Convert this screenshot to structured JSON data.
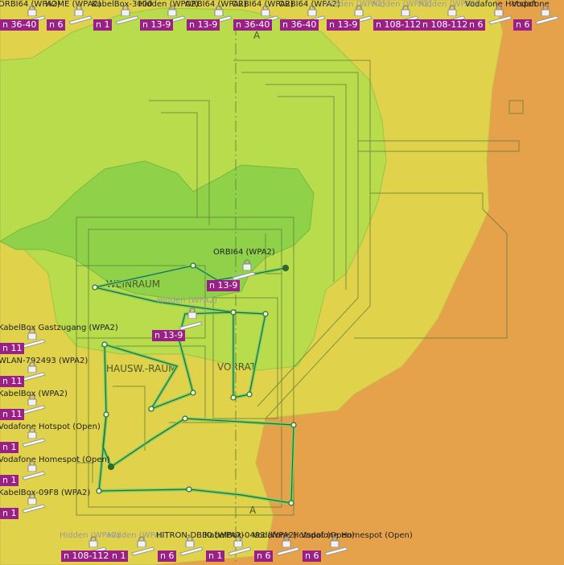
{
  "colors": {
    "strong": "#8fd24a",
    "good": "#b8dc4c",
    "ok": "#e0d24a",
    "weak": "#e6a24a",
    "channel_badge": "#9b1f86",
    "path": "#1e6b1e"
  },
  "rooms": {
    "weinraum": "WEINRAUM",
    "hausw_raum": "HAUSW.-RAUM",
    "vorrat": "VORRAT",
    "axis_top": "A",
    "axis_bottom": "A"
  },
  "top_row": [
    {
      "label": "ORBI64 (WPA2)",
      "channel": "n 36-40",
      "faded": false
    },
    {
      "label": "HOME (WPA2)",
      "channel": "n 6",
      "faded": false
    },
    {
      "label": "KabelBox-3000",
      "channel": "n 1",
      "faded": false
    },
    {
      "label": "Hidden (WPA2)",
      "channel": "n 13-9",
      "faded": false
    },
    {
      "label": "ORBI64 (WPA2)",
      "channel": "n 13-9",
      "faded": false
    },
    {
      "label": "ORBI64 (WPA2)",
      "channel": "n 36-40",
      "faded": false
    },
    {
      "label": "ORBI64 (WPA2)",
      "channel": "n 36-40",
      "faded": false
    },
    {
      "label": "Hidden (WPA2)",
      "channel": "n 13-9",
      "faded": true
    },
    {
      "label": "Hidden (WPA2)",
      "channel": "n 108-112",
      "faded": true
    },
    {
      "label": "Hidden (WPA2)",
      "channel": "n 108-112",
      "faded": true
    },
    {
      "label": "Vodafone Hotspot",
      "channel": "n 6",
      "faded": false
    },
    {
      "label": "Vodafone",
      "channel": "n 6",
      "faded": false
    }
  ],
  "left_column": [
    {
      "label": "KabelBox Gastzugang (WPA2)",
      "channel": "n 11"
    },
    {
      "label": "WLAN-792493 (WPA2)",
      "channel": "n 11"
    },
    {
      "label": "KabelBox (WPA2)",
      "channel": "n 11"
    },
    {
      "label": "Vodafone Hotspot (Open)",
      "channel": "n 1"
    },
    {
      "label": "Vodafone Homespot (Open)",
      "channel": "n 1"
    },
    {
      "label": "KabelBox-09F8 (WPA2)",
      "channel": "n 1"
    }
  ],
  "bottom_row": [
    {
      "label": "Hidden (WPA2)",
      "channel": "n 108-112",
      "faded": true
    },
    {
      "label": "Hidden (WPA2)",
      "channel": "n 1",
      "faded": true
    },
    {
      "label": "HITRON-DBE0 (WPA2)",
      "channel": "n 6",
      "faded": false
    },
    {
      "label": "KabelBox-0493 (WPA2)",
      "channel": "n 1",
      "faded": false
    },
    {
      "label": "Vodafone Hotspot (Open)",
      "channel": "n 6",
      "faded": false
    },
    {
      "label": "Vodafone Homespot (Open)",
      "channel": "n 6",
      "faded": false
    }
  ],
  "center_aps": [
    {
      "label": "ORBI64 (WPA2)",
      "channel": "n 13-9",
      "faded": false
    },
    {
      "label": "Hidden (WPA2)",
      "channel": "n 13-9",
      "faded": true
    }
  ]
}
